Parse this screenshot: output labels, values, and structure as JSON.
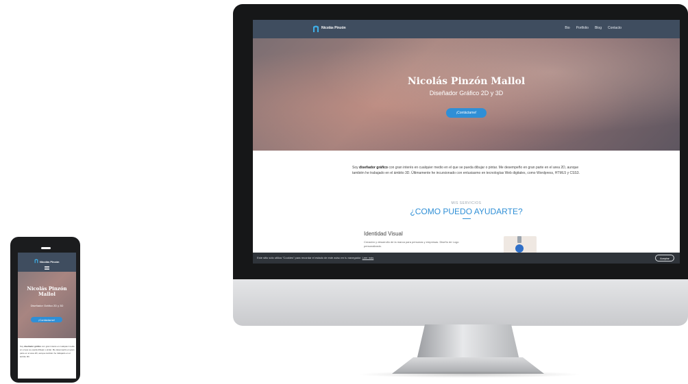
{
  "site": {
    "brand": "Nicolás Pinzón",
    "nav": [
      "Bio",
      "Portfolio",
      "Blog",
      "Contacto"
    ],
    "hero": {
      "title": "Nicolás Pinzón Mallol",
      "subtitle": "Diseñador Gráfico 2D y 3D",
      "cta": "¡Contáctame!"
    },
    "intro": {
      "prefix": "Soy ",
      "bold": "diseñador gráfico",
      "rest": " con gran interés en cualquier medio en el que se pueda dibujar o pintar. Me desempeño en gran parte en el area 2D, aunque también he trabajado en el ámbito 3D. Últimamente he incursionado con entusiasmo en tecnologías Web digitales, como Wordpress, HTML5 y CSS3."
    },
    "services": {
      "kicker": "MIS SERVICIOS",
      "heading": "¿COMO PUEDO AYUDARTE?",
      "item_title": "Identidad Visual",
      "item_desc": "Creación y desarrollo de la marca para personas y empresas. Diseño de Logo personalizado."
    },
    "cookie": {
      "text": "Este sitio sólo utiliza \"Cookies\" para recordar el estado de este aviso en tu navegador.",
      "link": "Leer más",
      "button": "Aceptar"
    }
  },
  "mobile": {
    "hero_title": "Nicolás Pinzón Mallol",
    "hero_subtitle": "Diseñador Gráfico 2D y 3D",
    "intro_prefix": "Soy ",
    "intro_bold": "diseñador gráfico",
    "intro_rest": " con gran interés en cualquier medio en el que se pueda dibujar o pintar. Me desempeño en gran parte en el area 2D, aunque también he trabajado en el ámbito 3D."
  },
  "colors": {
    "accent": "#2f8fd6",
    "nav": "#3f4d5f"
  }
}
